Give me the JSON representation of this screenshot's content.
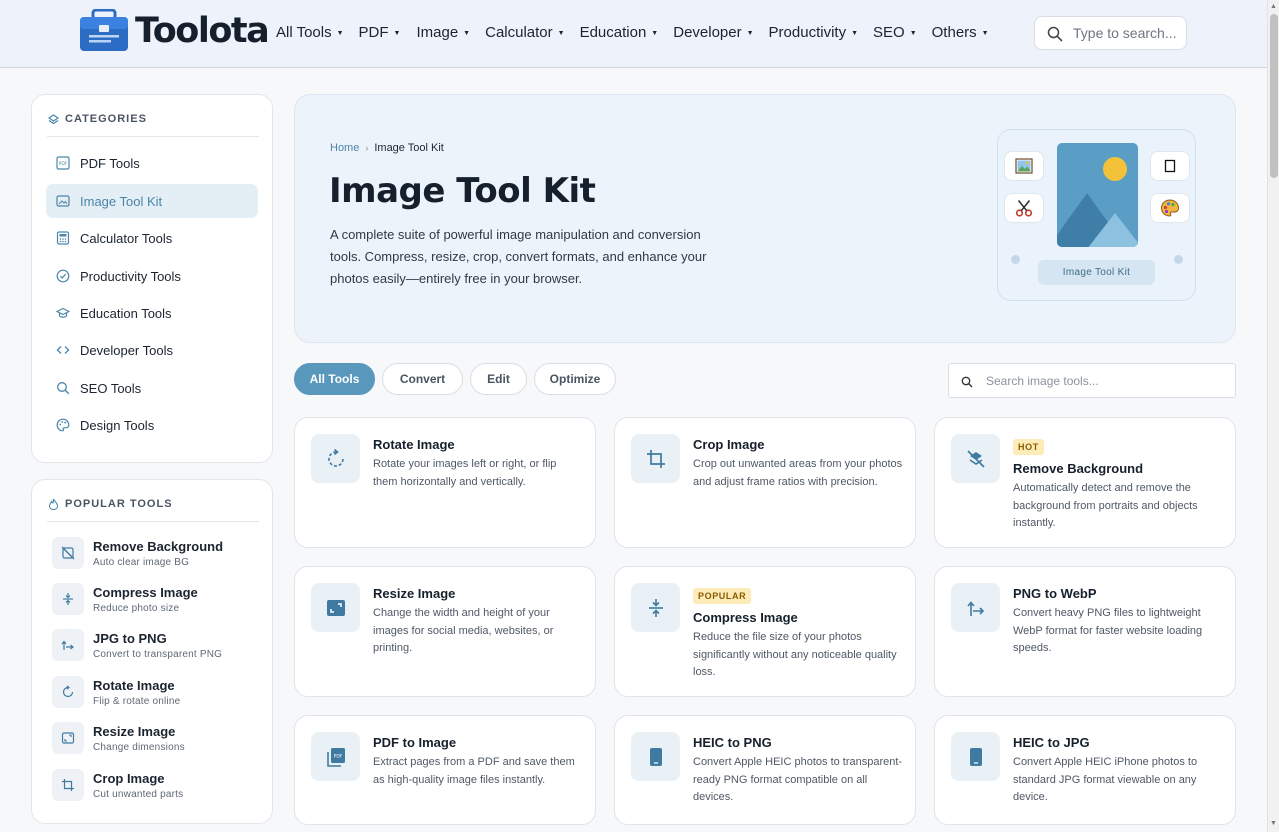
{
  "brand": {
    "name": "Toolota"
  },
  "nav": [
    {
      "label": "All Tools"
    },
    {
      "label": "PDF"
    },
    {
      "label": "Image"
    },
    {
      "label": "Calculator"
    },
    {
      "label": "Education"
    },
    {
      "label": "Developer"
    },
    {
      "label": "Productivity"
    },
    {
      "label": "SEO"
    },
    {
      "label": "Others"
    }
  ],
  "top_search": {
    "placeholder": "Type to search..."
  },
  "sidebar": {
    "categories_heading": "CATEGORIES",
    "categories": [
      {
        "label": "PDF Tools",
        "icon": "pdf-icon"
      },
      {
        "label": "Image Tool Kit",
        "icon": "image-icon",
        "active": true
      },
      {
        "label": "Calculator Tools",
        "icon": "calculator-icon"
      },
      {
        "label": "Productivity Tools",
        "icon": "check-circle-icon"
      },
      {
        "label": "Education Tools",
        "icon": "graduation-cap-icon"
      },
      {
        "label": "Developer Tools",
        "icon": "code-icon"
      },
      {
        "label": "SEO Tools",
        "icon": "search-icon"
      },
      {
        "label": "Design Tools",
        "icon": "palette-icon"
      }
    ],
    "popular_heading": "POPULAR TOOLS",
    "popular": [
      {
        "title": "Remove Background",
        "sub": "Auto clear image BG",
        "icon": "remove-bg-icon"
      },
      {
        "title": "Compress Image",
        "sub": "Reduce photo size",
        "icon": "compress-icon"
      },
      {
        "title": "JPG to PNG",
        "sub": "Convert to transparent PNG",
        "icon": "convert-icon"
      },
      {
        "title": "Rotate Image",
        "sub": "Flip & rotate online",
        "icon": "rotate-icon"
      },
      {
        "title": "Resize Image",
        "sub": "Change dimensions",
        "icon": "resize-icon"
      },
      {
        "title": "Crop Image",
        "sub": "Cut unwanted parts",
        "icon": "crop-icon"
      }
    ]
  },
  "hero": {
    "breadcrumb_home": "Home",
    "breadcrumb_current": "Image Tool Kit",
    "title": "Image Tool Kit",
    "description": "A complete suite of powerful image manipulation and conversion tools. Compress, resize, crop, convert formats, and enhance your photos easily—entirely free in your browser.",
    "illustration_label": "Image Tool Kit"
  },
  "filters": [
    {
      "label": "All Tools",
      "active": true
    },
    {
      "label": "Convert"
    },
    {
      "label": "Edit"
    },
    {
      "label": "Optimize"
    }
  ],
  "tools_search": {
    "placeholder": "Search image tools..."
  },
  "tools": [
    {
      "title": "Rotate Image",
      "desc": "Rotate your images left or right, or flip them horizontally and vertically.",
      "badge": "",
      "icon": "rotate-icon"
    },
    {
      "title": "Crop Image",
      "desc": "Crop out unwanted areas from your photos and adjust frame ratios with precision.",
      "badge": "",
      "icon": "crop-icon"
    },
    {
      "title": "Remove Background",
      "desc": "Automatically detect and remove the background from portraits and objects instantly.",
      "badge": "HOT",
      "icon": "remove-bg-icon"
    },
    {
      "title": "Resize Image",
      "desc": "Change the width and height of your images for social media, websites, or printing.",
      "badge": "",
      "icon": "resize-icon"
    },
    {
      "title": "Compress Image",
      "desc": "Reduce the file size of your photos significantly without any noticeable quality loss.",
      "badge": "POPULAR",
      "icon": "compress-icon"
    },
    {
      "title": "PNG to WebP",
      "desc": "Convert heavy PNG files to lightweight WebP format for faster website loading speeds.",
      "badge": "",
      "icon": "convert-icon"
    },
    {
      "title": "PDF to Image",
      "desc": "Extract pages from a PDF and save them as high-quality image files instantly.",
      "badge": "",
      "icon": "pdf-stack-icon"
    },
    {
      "title": "HEIC to PNG",
      "desc": "Convert Apple HEIC photos to transparent-ready PNG format compatible on all devices.",
      "badge": "",
      "icon": "phone-icon"
    },
    {
      "title": "HEIC to JPG",
      "desc": "Convert Apple HEIC iPhone photos to standard JPG format viewable on any device.",
      "badge": "",
      "icon": "phone-icon"
    }
  ],
  "colors": {
    "accent": "#5a97bd",
    "header_bg": "#eef2fb",
    "badge_bg": "#fdecb8"
  }
}
